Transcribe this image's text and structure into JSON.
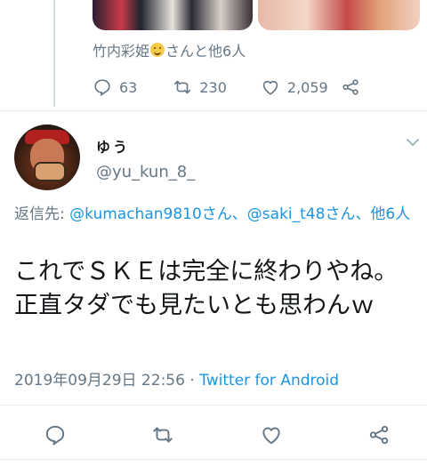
{
  "prev_tweet": {
    "liked_by_name": "竹内彩姫",
    "liked_by_suffix": "さんと他6人",
    "smile_icon": "smiling-face-emoji",
    "replies": "63",
    "retweets": "230",
    "likes": "2,059"
  },
  "tweet": {
    "display_name": "ゆう",
    "handle": "@yu_kun_8_",
    "reply_prefix": "返信先: ",
    "reply_user1": "@kumachan9810さん",
    "reply_sep": "、",
    "reply_user2": "@saki_t48さん",
    "reply_more": "、他6人",
    "text": "これでＳＫＥは完全に終わりやね。正直タダでも見たいとも思わんｗ",
    "timestamp": "2019年09月29日 22:56",
    "meta_sep": " · ",
    "app": "Twitter for Android"
  },
  "colors": {
    "link": "#1b95e0",
    "secondary": "#657786",
    "text": "#14171a",
    "divider": "#e6ecf0"
  }
}
